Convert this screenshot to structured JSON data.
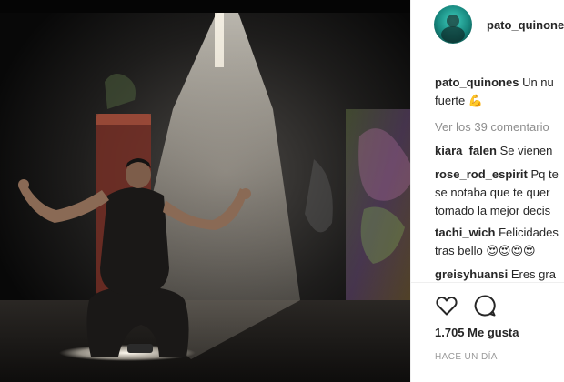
{
  "post": {
    "username": "pato_quinones",
    "caption_user": "pato_quinones",
    "caption_text_line1": "Un nu",
    "caption_text_line2": "fuerte 💪",
    "view_comments": "Ver los 39 comentario",
    "likes": "1.705 Me gusta",
    "timestamp": "HACE UN DÍA"
  },
  "comments": [
    {
      "user": "kiara_falen",
      "line1": "Se vienen",
      "line2": ""
    },
    {
      "user": "rose_rod_espirit",
      "line1": "Pq te",
      "line2": "se notaba que te quer",
      "line3": "tomado la mejor decis"
    },
    {
      "user": "tachi_wich",
      "line1": "Felicidades",
      "line2": "tras bello 😍😍😍😍"
    },
    {
      "user": "greisyhuansi",
      "line1": "Eres gra",
      "line2": ""
    }
  ],
  "icons": {
    "like": "heart-outline-icon",
    "comment": "speech-bubble-icon"
  },
  "colors": {
    "text": "#262626",
    "muted": "#8e8e8e",
    "border": "#efefef"
  }
}
